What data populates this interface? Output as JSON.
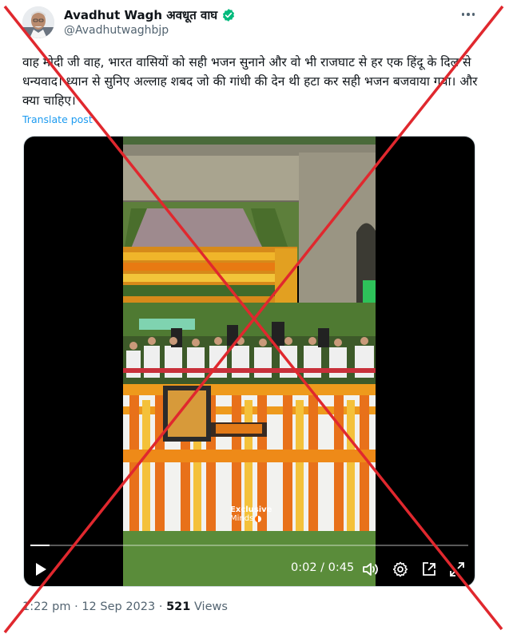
{
  "author": {
    "display_name": "Avadhut Wagh अवधूत वाघ",
    "handle": "@Avadhutwaghbjp",
    "avatar_icon": "profile-photo",
    "verified_icon": "verified-badge-icon",
    "verified_color": "#00ba7c"
  },
  "tweet": {
    "text": "वाह मोदी जी वाह, भारत वासियों को सही भजन सुनाने और वो भी राजघाट से हर एक हिंदू के दिल से धन्यवाद। ध्यान से सुनिए अल्लाह शबद जो की गांधी की देन थी हटा कर सही भजन बजवाया गया। और क्या चाहिए।",
    "translate_label": "Translate post"
  },
  "video": {
    "watermark_line1": "Exclusive",
    "watermark_line2": "Minds",
    "current_time": "0:02",
    "duration": "0:45",
    "time_display": "0:02 / 0:45",
    "progress_fraction": 0.044,
    "controls": [
      "play-icon",
      "volume-icon",
      "settings-icon",
      "pip-icon",
      "fullscreen-icon"
    ]
  },
  "meta": {
    "time": "1:22 pm",
    "separator": "·",
    "date": "12 Sep 2023",
    "views_count": "521",
    "views_label": "Views"
  },
  "overlay": {
    "cross_color": "#e0282e"
  },
  "colors": {
    "link": "#1d9bf0",
    "secondary_text": "#536471"
  }
}
